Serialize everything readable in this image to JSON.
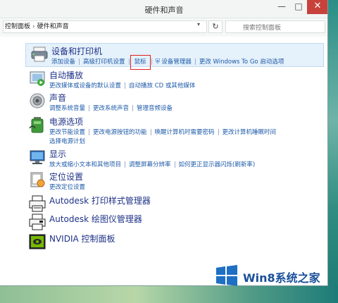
{
  "window": {
    "title": "硬件和声音",
    "min": "—",
    "max": "□",
    "close": "✕"
  },
  "address": {
    "crumbs": [
      "控制面板",
      "硬件和声音"
    ],
    "separator": "›",
    "dropdown": "▾",
    "refresh": "↻",
    "search_placeholder": "搜索控制面板"
  },
  "sections": [
    {
      "title": "设备和打印机",
      "icon": "printer-icon",
      "links": [
        "添加设备",
        "高级打印机设置",
        "鼠标",
        "设备管理器",
        "更改 Windows To Go 启动选项"
      ]
    },
    {
      "title": "自动播放",
      "icon": "autoplay-icon",
      "links": [
        "更改媒体或设备的默认设置",
        "自动播放 CD 或其他媒体"
      ]
    },
    {
      "title": "声音",
      "icon": "speaker-icon",
      "links": [
        "调整系统音量",
        "更改系统声音",
        "管理音频设备"
      ]
    },
    {
      "title": "电源选项",
      "icon": "battery-icon",
      "links": [
        "更改节能设置",
        "更改电源按钮的功能",
        "唤醒计算机时需要密码",
        "更改计算机睡眠时间",
        "选择电源计划"
      ]
    },
    {
      "title": "显示",
      "icon": "display-icon",
      "links": [
        "放大或缩小文本和其他项目",
        "调整屏幕分辨率",
        "如何更正显示器闪烁(刷新率)"
      ]
    },
    {
      "title": "定位设置",
      "icon": "location-icon",
      "links": [
        "更改定位设置"
      ]
    },
    {
      "title": "Autodesk 打印样式管理器",
      "icon": "plot-style-icon",
      "links": []
    },
    {
      "title": "Autodesk 绘图仪管理器",
      "icon": "plotter-icon",
      "links": []
    },
    {
      "title": "NVIDIA 控制面板",
      "icon": "nvidia-icon",
      "links": []
    }
  ],
  "watermark": {
    "text": "Win8系统之家",
    "tile_colors": [
      "#1f6fc5",
      "#1f6fc5",
      "#1f6fc5",
      "#1f6fc5"
    ]
  },
  "colors": {
    "link": "#1e5aa8",
    "title": "#1e3287",
    "highlight_box": "#e01e1e"
  }
}
